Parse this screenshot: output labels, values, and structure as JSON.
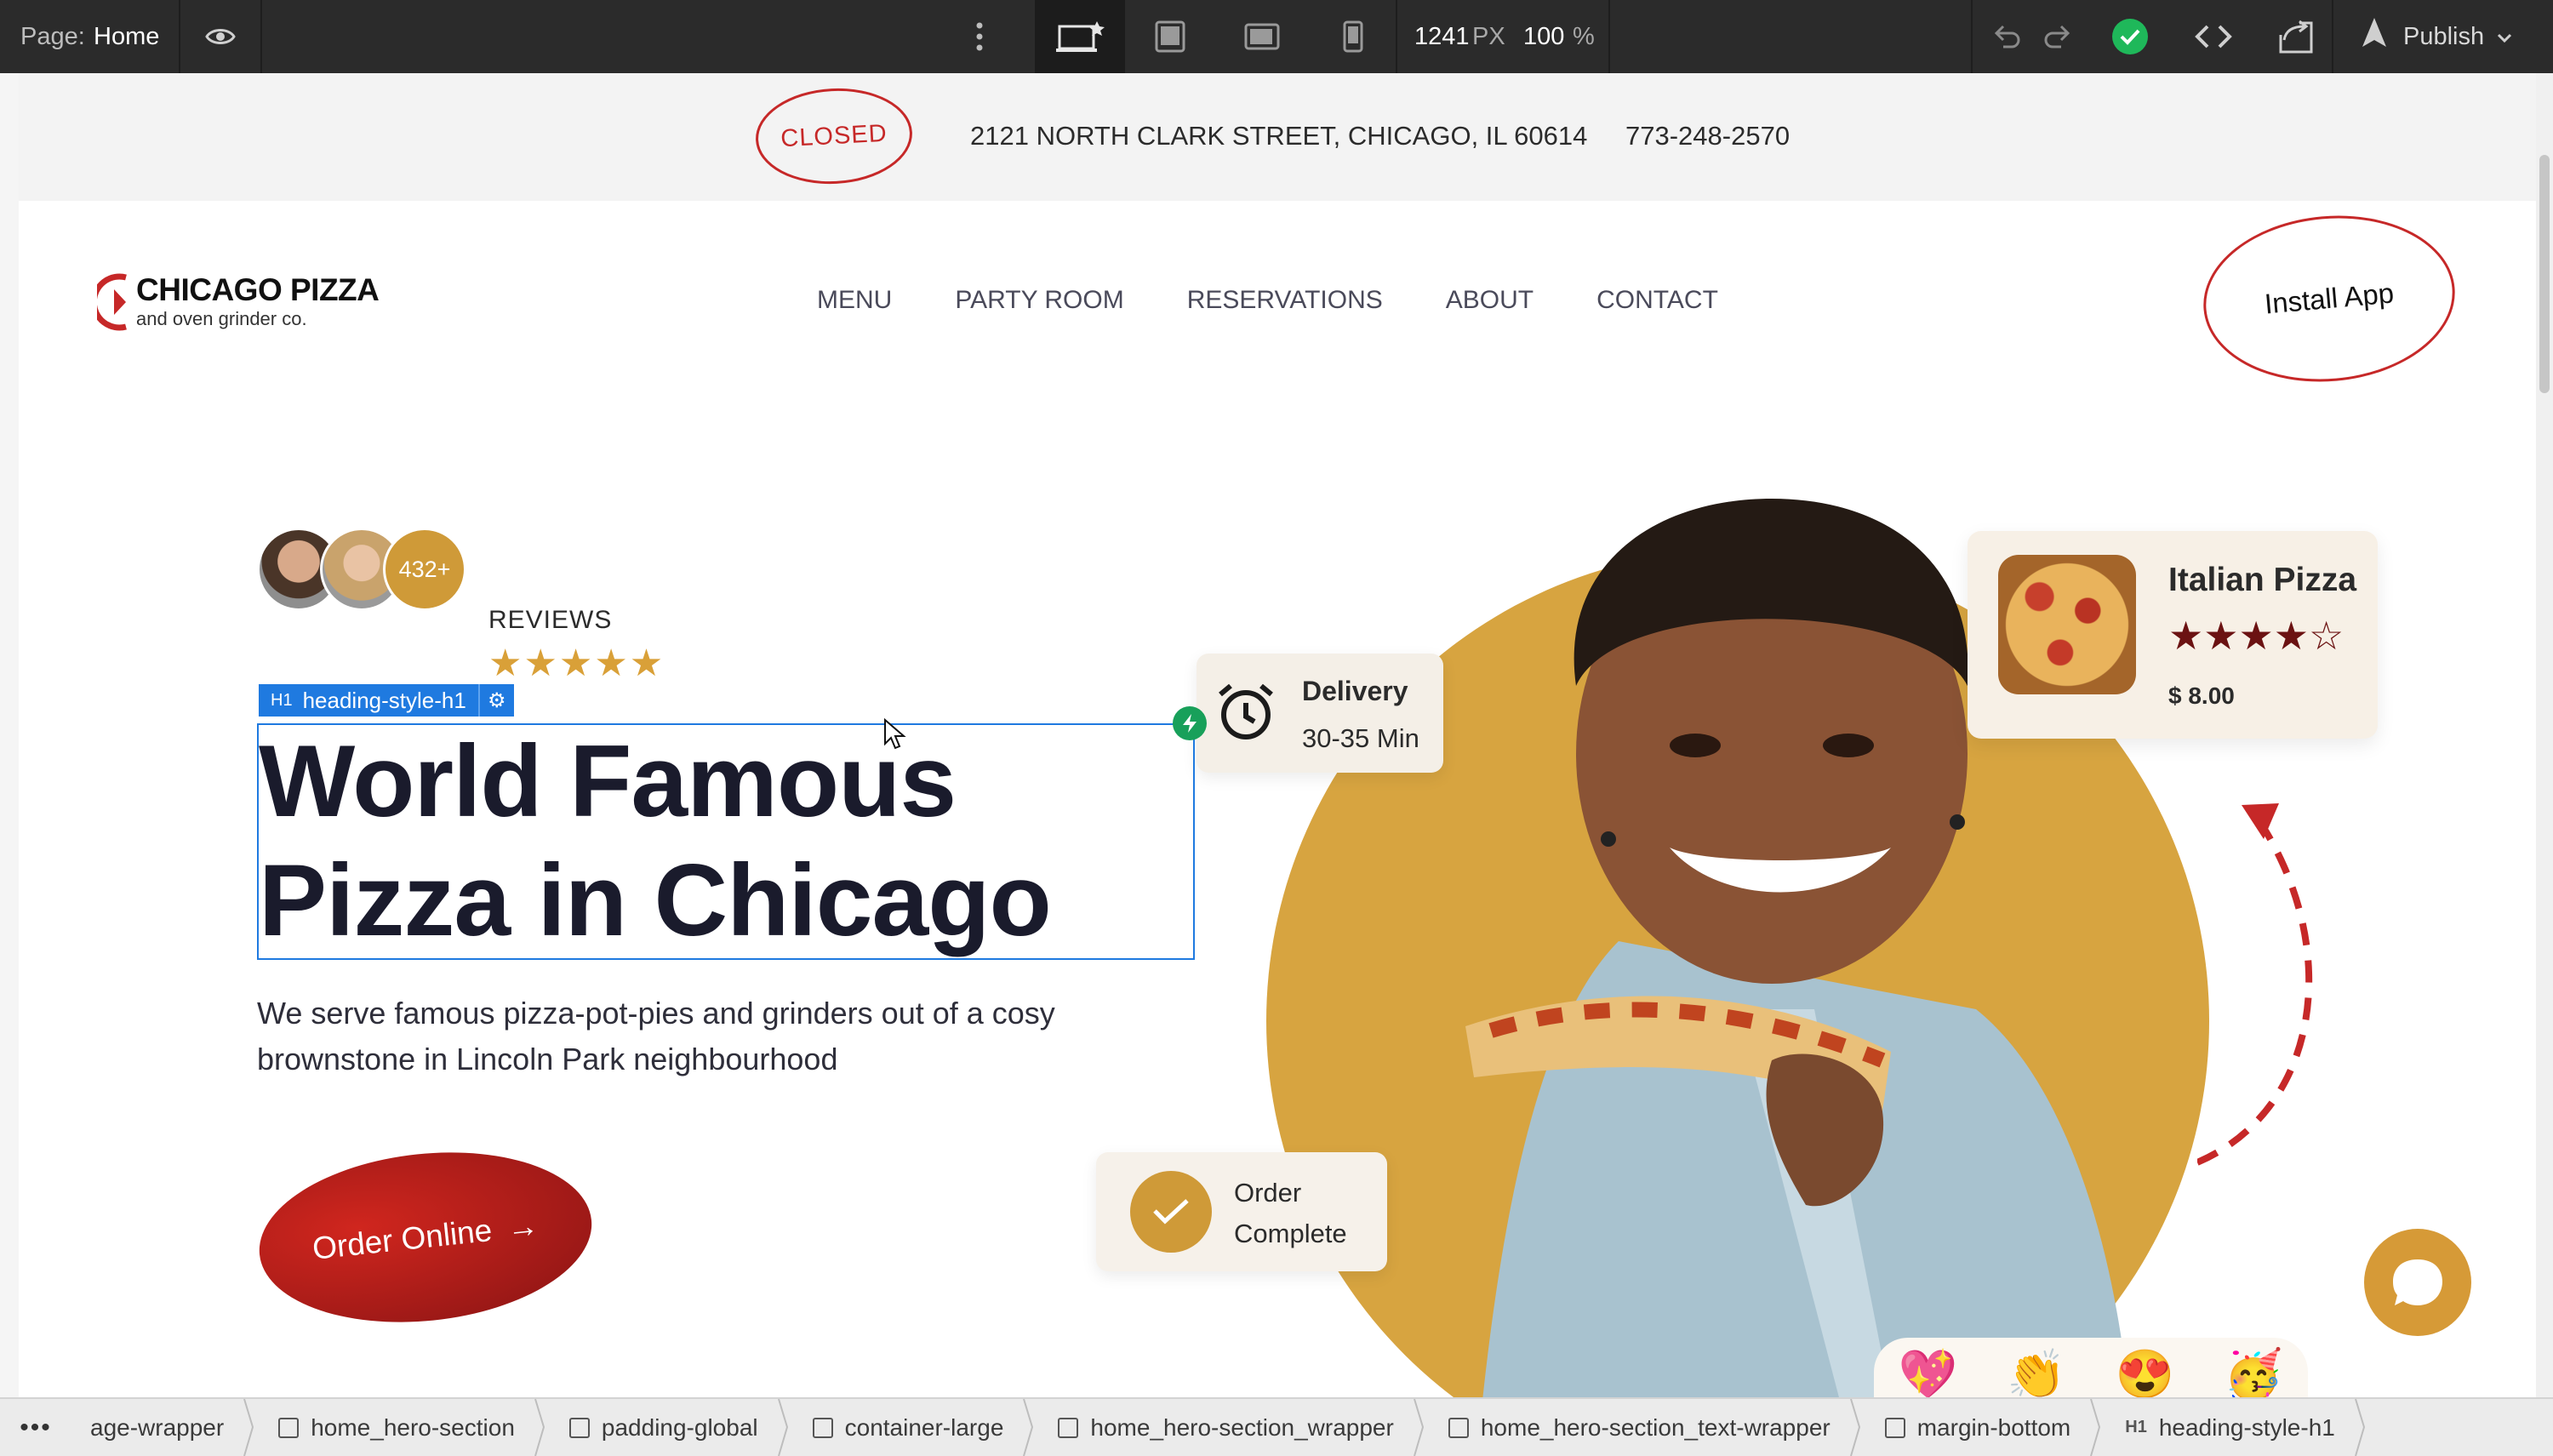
{
  "toolbar": {
    "page_label": "Page:",
    "page_name": "Home",
    "width_value": "1241",
    "width_unit": "PX",
    "zoom_value": "100",
    "zoom_unit": "%",
    "publish_label": "Publish",
    "icons": [
      "eye-icon",
      "more-vertical-icon",
      "desktop-icon",
      "tablet-icon",
      "tablet-landscape-icon",
      "phone-icon",
      "undo-icon",
      "redo-icon",
      "check-circle-icon",
      "code-icon",
      "export-icon",
      "publish-rocket-icon",
      "chevron-down-icon"
    ]
  },
  "site": {
    "status": "CLOSED",
    "address": "2121  NORTH CLARK STREET, CHICAGO, IL 60614",
    "phone": "773-248-2570",
    "logo_name": "CHICAGO PIZZA",
    "logo_tagline": "and oven grinder co.",
    "nav": [
      "MENU",
      "PARTY ROOM",
      "RESERVATIONS",
      "ABOUT",
      "CONTACT"
    ],
    "install_app": "Install App",
    "reviews_count": "432+",
    "reviews_label": "REVIEWS",
    "reviews_stars": "★★★★★",
    "heading_line1": "World Famous",
    "heading_line2": "Pizza in Chicago",
    "subheading": "We serve famous pizza-pot-pies and grinders out of a cosy brownstone in Lincoln Park neighbourhood",
    "order_online": "Order Online",
    "order_arrow": "→",
    "delivery_title": "Delivery",
    "delivery_time": "30-35 Min",
    "product_name": "Italian Pizza",
    "product_stars": "★★★★☆",
    "product_price": "$ 8.00",
    "order_complete": "Order Complete",
    "reactions": [
      "💖",
      "👏",
      "😍",
      "🥳"
    ]
  },
  "selection": {
    "tag": "H1",
    "class_name": "heading-style-h1"
  },
  "breadcrumbs": [
    {
      "label": "age-wrapper",
      "icon": "none"
    },
    {
      "label": "home_hero-section",
      "icon": "box"
    },
    {
      "label": "padding-global",
      "icon": "box"
    },
    {
      "label": "container-large",
      "icon": "box"
    },
    {
      "label": "home_hero-section_wrapper",
      "icon": "box"
    },
    {
      "label": "home_hero-section_text-wrapper",
      "icon": "box"
    },
    {
      "label": "margin-bottom",
      "icon": "box"
    },
    {
      "label": "heading-style-h1",
      "icon": "h1"
    }
  ],
  "colors": {
    "accent_gold": "#d7a440",
    "brand_red": "#c62828",
    "selection_blue": "#1f7ae0",
    "toolbar_bg": "#2b2b2b"
  }
}
